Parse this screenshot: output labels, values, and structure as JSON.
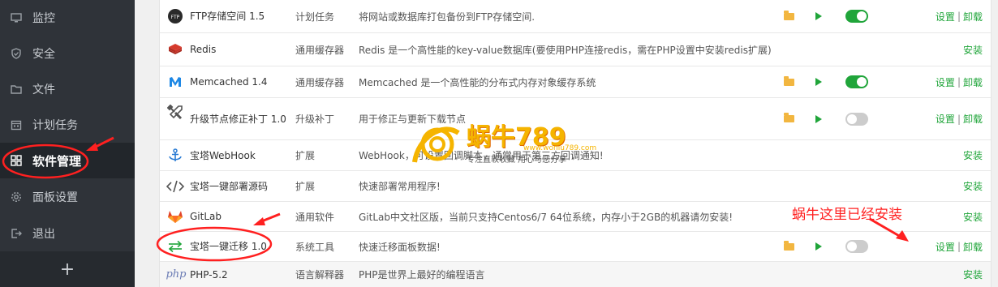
{
  "sidebar": {
    "items": [
      {
        "label": "监控",
        "icon": "monitor-icon"
      },
      {
        "label": "安全",
        "icon": "shield-icon"
      },
      {
        "label": "文件",
        "icon": "folder-icon"
      },
      {
        "label": "计划任务",
        "icon": "calendar-icon"
      },
      {
        "label": "软件管理",
        "icon": "grid-icon",
        "active": true
      },
      {
        "label": "面板设置",
        "icon": "gear-icon"
      },
      {
        "label": "退出",
        "icon": "logout-icon"
      }
    ],
    "add_label": "+"
  },
  "software": {
    "rows": [
      {
        "name": "FTP存储空间 1.5",
        "type": "计划任务",
        "desc": "将网站或数据库打包备份到FTP存储空间.",
        "icon": "ftp-icon",
        "folder": true,
        "play": true,
        "toggle": "on",
        "ops": [
          "设置",
          "卸载"
        ]
      },
      {
        "name": "Redis",
        "type": "通用缓存器",
        "desc": "Redis 是一个高性能的key-value数据库(要使用PHP连接redis，需在PHP设置中安装redis扩展)",
        "icon": "redis-icon",
        "folder": false,
        "play": false,
        "toggle": "none",
        "ops": [
          "安装"
        ]
      },
      {
        "name": "Memcached 1.4",
        "type": "通用缓存器",
        "desc": "Memcached 是一个高性能的分布式内存对象缓存系统",
        "icon": "memcached-icon",
        "folder": true,
        "play": true,
        "toggle": "on",
        "ops": [
          "设置",
          "卸载"
        ]
      },
      {
        "name": "升级节点修正补丁 1.0",
        "type": "升级补丁",
        "desc": "用于修正与更新下载节点",
        "icon": "tools-icon",
        "folder": true,
        "play": true,
        "toggle": "off",
        "ops": [
          "设置",
          "卸载"
        ]
      },
      {
        "name": "宝塔WebHook",
        "type": "扩展",
        "desc": "WebHook，可设置回调脚本，通常用于第三方回调通知!",
        "icon": "anchor-icon",
        "folder": false,
        "play": false,
        "toggle": "none",
        "ops": [
          "安装"
        ]
      },
      {
        "name": "宝塔一键部署源码",
        "type": "扩展",
        "desc": "快速部署常用程序!",
        "icon": "code-icon",
        "folder": false,
        "play": false,
        "toggle": "none",
        "ops": [
          "安装"
        ]
      },
      {
        "name": "GitLab",
        "type": "通用软件",
        "desc": "GitLab中文社区版，当前只支持Centos6/7 64位系统，内存小于2GB的机器请勿安装!",
        "icon": "gitlab-icon",
        "folder": false,
        "play": false,
        "toggle": "none",
        "ops": [
          "安装"
        ]
      },
      {
        "name": "宝塔一键迁移 1.0",
        "type": "系统工具",
        "desc": "快速迁移面板数据!",
        "icon": "transfer-icon",
        "folder": true,
        "play": true,
        "toggle": "off",
        "ops": [
          "设置",
          "卸载"
        ]
      },
      {
        "name": "PHP-5.2",
        "type": "语言解释器",
        "desc": "PHP是世界上最好的编程语言",
        "icon": "php-icon",
        "folder": false,
        "play": false,
        "toggle": "none",
        "ops": [
          "安装"
        ]
      }
    ]
  },
  "annotation": {
    "note": "蜗牛这里已经安装",
    "color": "#ff2020"
  },
  "watermark": {
    "brand": "蜗牛789",
    "url": "www.woniu789.com",
    "slogan": "专注直软收藏 用心与您分享"
  },
  "colors": {
    "accent": "#20a53a",
    "sidebar": "#2f3339"
  }
}
